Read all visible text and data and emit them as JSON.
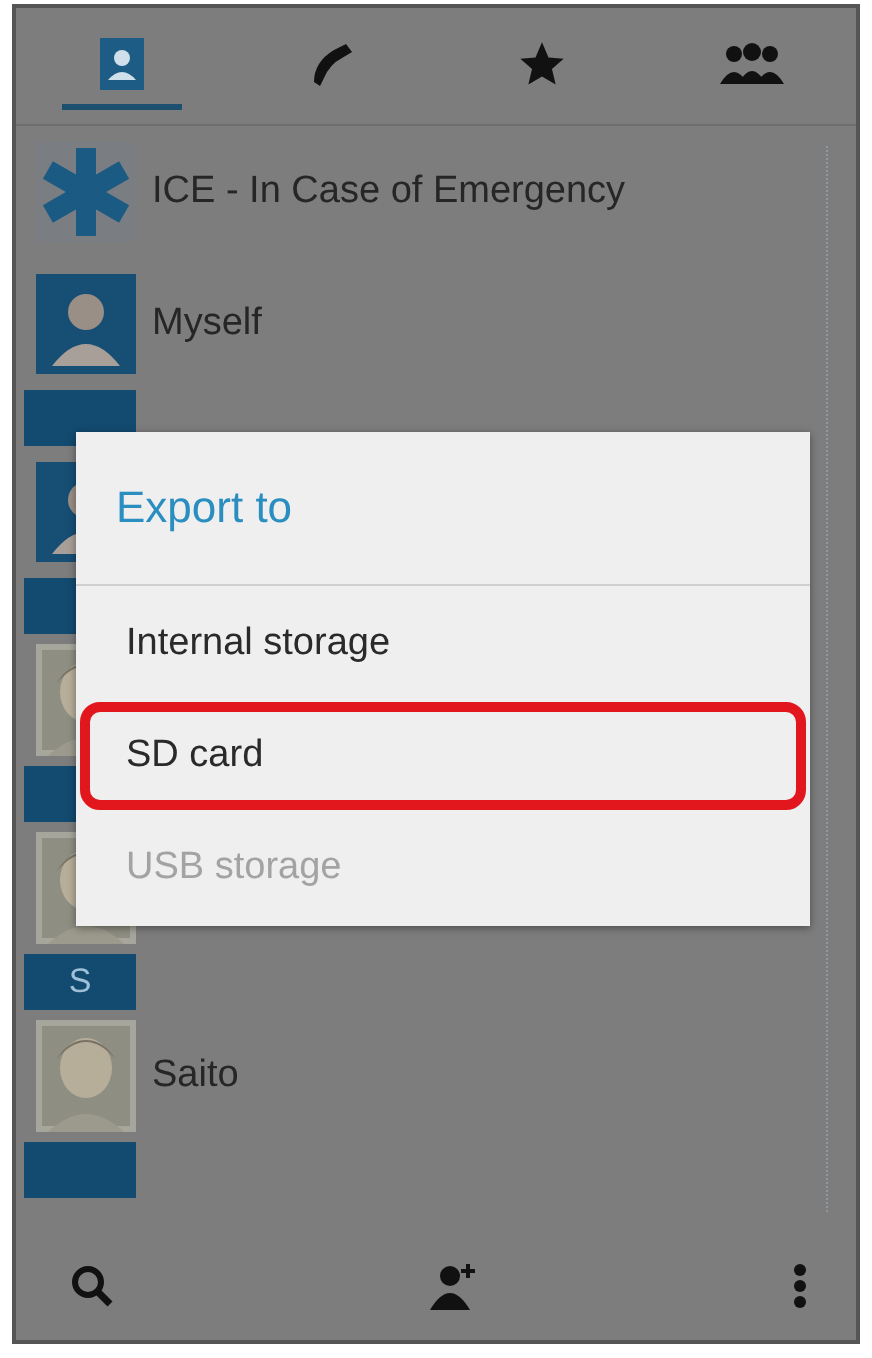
{
  "tabs": [
    {
      "kind": "contacts",
      "selected": true
    },
    {
      "kind": "phone",
      "selected": false
    },
    {
      "kind": "favorites",
      "selected": false
    },
    {
      "kind": "groups",
      "selected": false
    }
  ],
  "list": [
    {
      "kind": "contact",
      "avatar": {
        "kind": "ice"
      },
      "name": "ICE - In Case of Emergency"
    },
    {
      "kind": "contact",
      "avatar": {
        "kind": "silhouette"
      },
      "name": "Myself"
    },
    {
      "kind": "header"
    },
    {
      "kind": "contact",
      "avatar": {
        "kind": "silhouette"
      }
    },
    {
      "kind": "header"
    },
    {
      "kind": "contact"
    },
    {
      "kind": "header"
    },
    {
      "kind": "contact"
    },
    {
      "kind": "header",
      "label": "S"
    },
    {
      "kind": "contact",
      "name": "Saito"
    },
    {
      "kind": "header"
    }
  ],
  "dialog": {
    "title": "Export to",
    "items": [
      {
        "label": "Internal storage",
        "disabled": false,
        "highlighted": false
      },
      {
        "label": "SD card",
        "disabled": false,
        "highlighted": true
      },
      {
        "label": "USB storage",
        "disabled": true,
        "highlighted": false
      }
    ]
  },
  "bottom_bar": [
    {
      "kind": "search"
    },
    {
      "kind": "add-contact"
    },
    {
      "kind": "more"
    }
  ]
}
